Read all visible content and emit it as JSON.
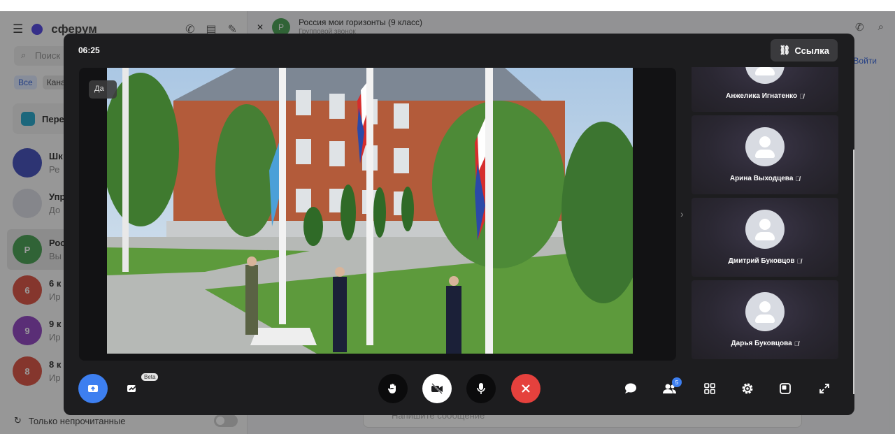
{
  "background_app": {
    "brand": "сферум",
    "search_placeholder": "Поиск",
    "filters": [
      "Все",
      "Кана"
    ],
    "pinned_label": "Пере",
    "chats": [
      {
        "avatar": "",
        "title": "Шк",
        "preview": "Ре",
        "color": "#3a46b8"
      },
      {
        "avatar": "",
        "title": "Упр",
        "preview": "До",
        "color": "#d9dbe3"
      },
      {
        "avatar": "Р",
        "title": "Рос",
        "preview": "Вы",
        "color": "#3e9c4a"
      },
      {
        "avatar": "6",
        "title": "6 к",
        "preview": "Ир",
        "color": "#d94a3a"
      },
      {
        "avatar": "9",
        "title": "9 к",
        "preview": "Ир",
        "color": "#8a3bbd"
      },
      {
        "avatar": "8",
        "title": "8 к",
        "preview": "Ир",
        "color": "#d94a3a"
      }
    ],
    "unread_only_label": "Только непрочитанные",
    "conversation_avatar": "Р",
    "conversation_title": "Россия мои горизонты (9 класс)",
    "conversation_subtitle": "Групповой звонок",
    "join_label": "Войти",
    "message_placeholder": "Напишите сообщение"
  },
  "call": {
    "timer": "06:25",
    "link_label": "Ссылка",
    "speaker_tag": "Да",
    "participants": [
      {
        "name": "Анжелика Игнатенко",
        "muted": true
      },
      {
        "name": "Арина Выходцева",
        "muted": true
      },
      {
        "name": "Дмитрий Буковцов",
        "muted": true
      },
      {
        "name": "Дарья Буковцова",
        "muted": true
      }
    ],
    "beta_label": "Beta",
    "participants_count": "5"
  },
  "icons": {
    "share": "share-screen-icon",
    "board": "whiteboard-icon",
    "raise": "raise-hand-icon",
    "camera": "camera-off-icon",
    "mic": "microphone-icon",
    "end": "end-call-icon",
    "chat": "chat-icon",
    "people": "participants-icon",
    "grid": "grid-layout-icon",
    "settings": "gear-icon",
    "pip": "pip-icon",
    "fullscreen": "fullscreen-icon"
  },
  "colors": {
    "accent": "#3d7ff0",
    "end_call": "#e5413d",
    "panel": "#1d1d1f"
  }
}
